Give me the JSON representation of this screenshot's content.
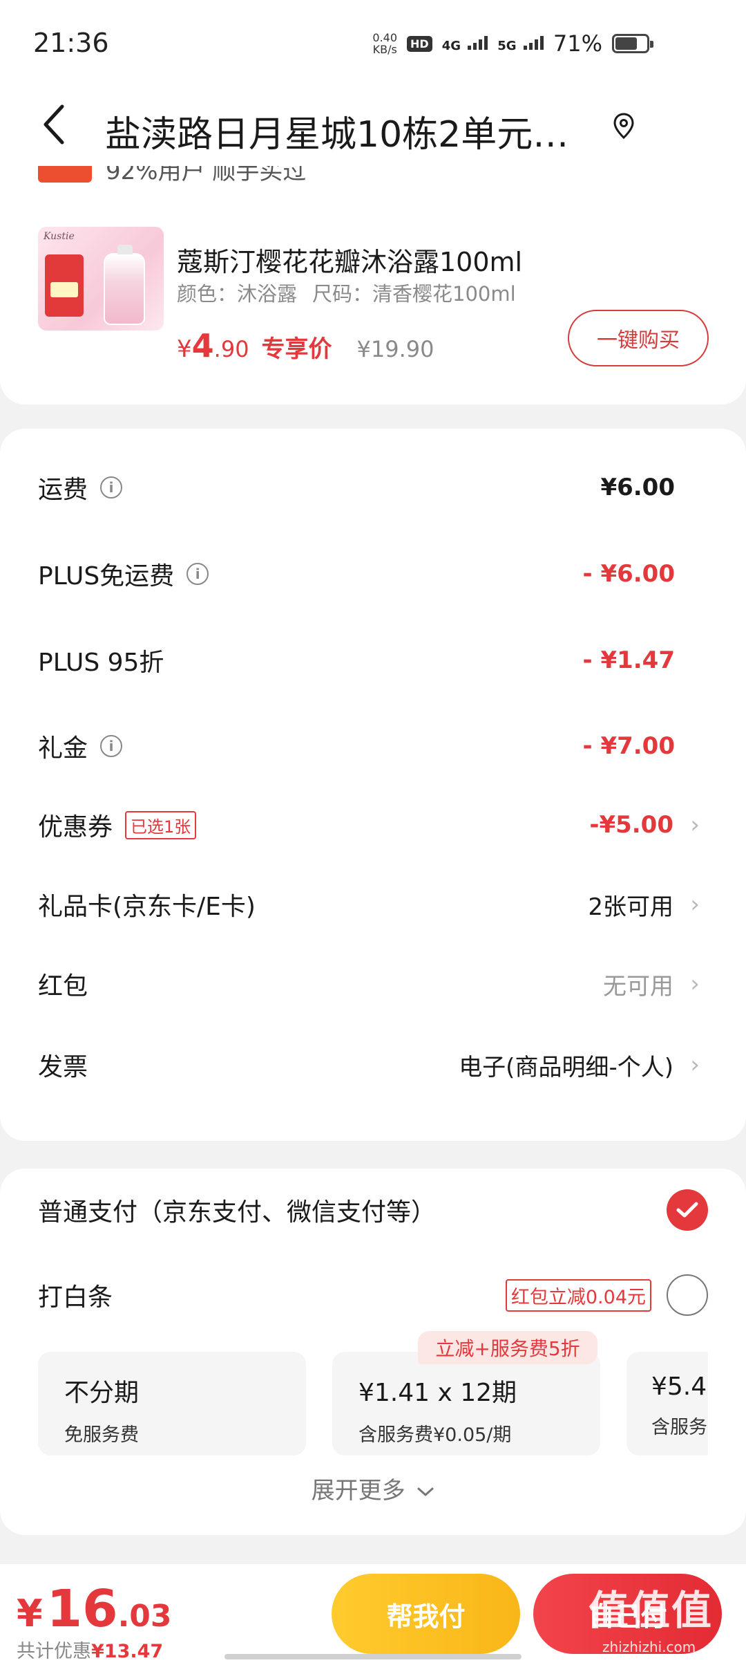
{
  "status_bar": {
    "time": "21:36",
    "speed_value": "0.40",
    "speed_unit": "KB/s",
    "hd": "HD",
    "net1": "4G",
    "net2": "5G",
    "battery": "71%",
    "battery_level": 0.71
  },
  "header": {
    "address": "盐渎路日月星城10栋2单元…"
  },
  "product": {
    "cut_text": "92%用户 顺手买过",
    "title": "蔻斯汀樱花花瓣沐浴露100ml",
    "color_spec": "颜色：沐浴露",
    "size_spec": "尺码：清香樱花100ml",
    "price_symbol": "¥",
    "price_int": "4",
    "price_dec": ".90",
    "price_tag": "专享价",
    "original_price": "¥19.90",
    "buy_button": "一键购买"
  },
  "fees": {
    "shipping_label": "运费",
    "shipping_value": "¥6.00",
    "plus_free_label": "PLUS免运费",
    "plus_free_value": "- ¥6.00",
    "plus_discount_label": "PLUS 95折",
    "plus_discount_value": "- ¥1.47",
    "gift_label": "礼金",
    "gift_value": "- ¥7.00",
    "coupon_label": "优惠券",
    "coupon_badge": "已选1张",
    "coupon_value": "-¥5.00",
    "giftcard_label": "礼品卡(京东卡/E卡)",
    "giftcard_value": "2张可用",
    "redpacket_label": "红包",
    "redpacket_value": "无可用",
    "invoice_label": "发票",
    "invoice_value": "电子(商品明细-个人)"
  },
  "payment": {
    "normal_label": "普通支付（京东支付、微信支付等）",
    "baitiao_label": "打白条",
    "baitiao_badge": "红包立减0.04元",
    "plan_tag": "立减+服务费5折",
    "plans": [
      {
        "title": "不分期",
        "sub": "免服务费"
      },
      {
        "title": "¥1.41 x 12期",
        "sub": "含服务费¥0.05/期"
      },
      {
        "title": "¥5.4",
        "sub": "含服务"
      }
    ],
    "more": "展开更多"
  },
  "bottom": {
    "total_symbol": "¥",
    "total_int": "16",
    "total_dec": ".03",
    "saving_label": "共计优惠",
    "saving_value": "¥13.47",
    "help_pay": "帮我付",
    "self_pay": "自己付",
    "watermark_glyphs": "值值值",
    "watermark_url": "zhizhizhi.com"
  },
  "colors": {
    "accent_red": "#e4393c",
    "help_yellow": "#f9b618",
    "background": "#f2f2f2"
  }
}
